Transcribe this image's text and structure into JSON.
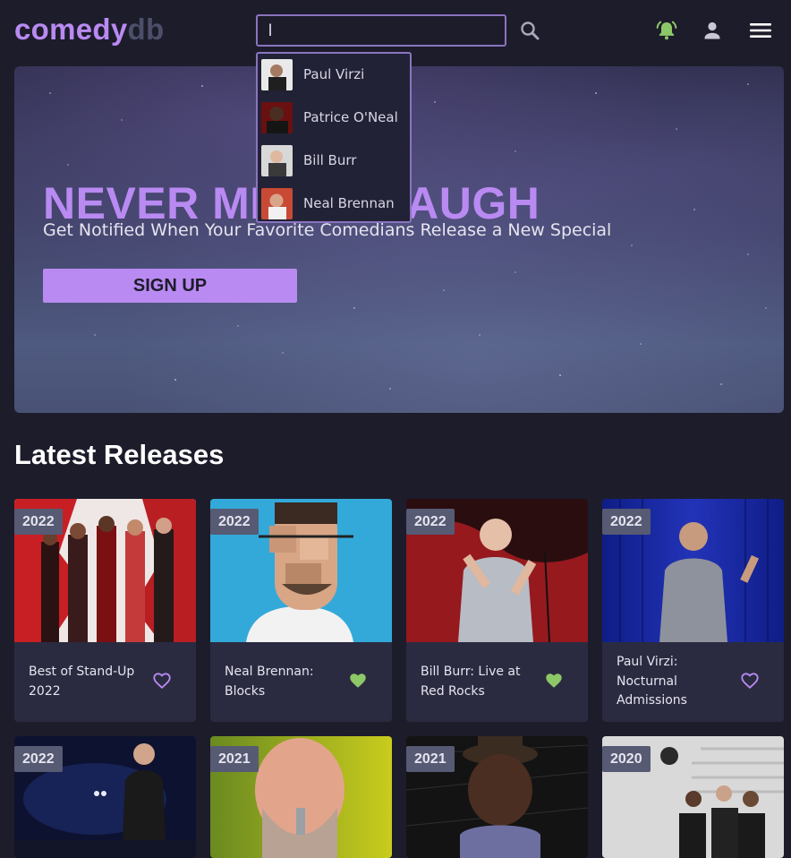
{
  "app": {
    "logo_primary": "comedy",
    "logo_secondary": "db",
    "search_value": "l"
  },
  "icons": {
    "search": "search-icon",
    "bell": "bell-icon",
    "user": "user-icon",
    "menu": "menu-icon",
    "heart": "heart-icon"
  },
  "colors": {
    "accent": "#b98af2",
    "bell": "#8dc867",
    "heart_filled": "#8dc867",
    "heart_outline": "#b98af2",
    "background": "#1d1c2b",
    "card": "#2a2b40"
  },
  "dropdown": {
    "results": [
      {
        "name": "Paul Virzi"
      },
      {
        "name": "Patrice O'Neal"
      },
      {
        "name": "Bill Burr"
      },
      {
        "name": "Neal Brennan"
      }
    ]
  },
  "hero": {
    "title": "NEVER MISS A LAUGH",
    "subtitle": "Get Notified When Your Favorite Comedians Release a New Special",
    "cta": "SIGN UP"
  },
  "latest": {
    "heading": "Latest Releases",
    "cards": [
      {
        "year": "2022",
        "title": "Best of Stand-Up 2022",
        "favorited": false
      },
      {
        "year": "2022",
        "title": "Neal Brennan: Blocks",
        "favorited": true
      },
      {
        "year": "2022",
        "title": "Bill Burr: Live at Red Rocks",
        "favorited": true
      },
      {
        "year": "2022",
        "title": "Paul Virzi: Nocturnal Admissions",
        "favorited": false
      },
      {
        "year": "2022",
        "title": "",
        "favorited": false
      },
      {
        "year": "2021",
        "title": "",
        "favorited": false
      },
      {
        "year": "2021",
        "title": "",
        "favorited": false
      },
      {
        "year": "2020",
        "title": "",
        "favorited": false
      }
    ]
  }
}
